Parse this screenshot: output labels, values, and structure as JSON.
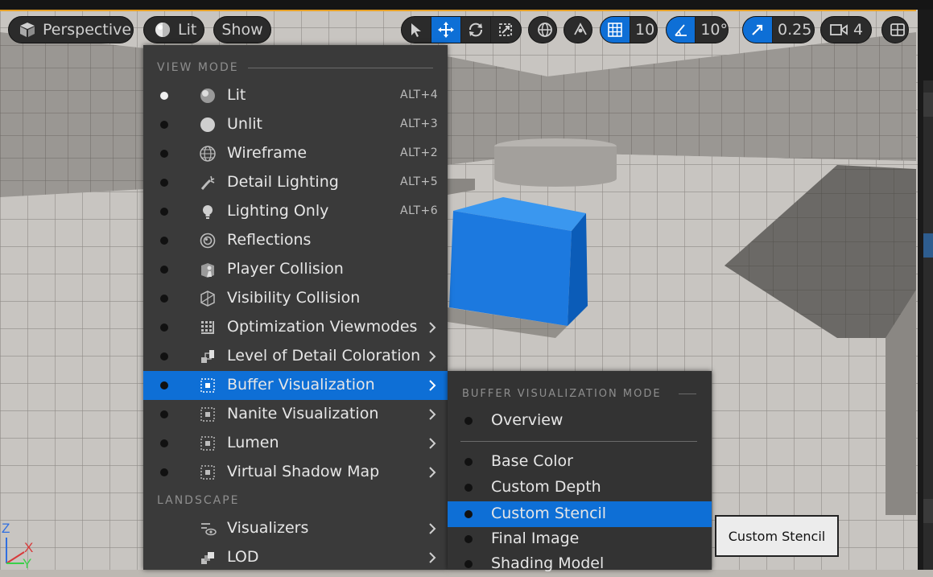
{
  "toolbar": {
    "perspective_label": "Perspective",
    "lit_label": "Lit",
    "show_label": "Show",
    "grid_value": "10",
    "angle_value": "10°",
    "scale_value": "0.25",
    "camera_speed": "4"
  },
  "colors": {
    "accent": "#0e6fd6",
    "menu_bg": "#3a3a3a",
    "submenu_bg": "#333333",
    "highlight_frame": "#e7a126"
  },
  "view_mode_menu": {
    "section_view_mode": "VIEW MODE",
    "section_landscape": "LANDSCAPE",
    "items": [
      {
        "label": "Lit",
        "shortcut": "ALT+4",
        "icon": "lit-sphere-icon"
      },
      {
        "label": "Unlit",
        "shortcut": "ALT+3",
        "icon": "unlit-sphere-icon"
      },
      {
        "label": "Wireframe",
        "shortcut": "ALT+2",
        "icon": "wireframe-globe-icon"
      },
      {
        "label": "Detail Lighting",
        "shortcut": "ALT+5",
        "icon": "detail-lighting-icon"
      },
      {
        "label": "Lighting Only",
        "shortcut": "ALT+6",
        "icon": "lightbulb-icon"
      },
      {
        "label": "Reflections",
        "shortcut": "",
        "icon": "reflections-icon"
      },
      {
        "label": "Player Collision",
        "shortcut": "",
        "icon": "player-collision-icon"
      },
      {
        "label": "Visibility Collision",
        "shortcut": "",
        "icon": "visibility-collision-icon"
      },
      {
        "label": "Optimization Viewmodes",
        "shortcut": "",
        "icon": "optimization-grid-icon"
      },
      {
        "label": "Level of Detail Coloration",
        "shortcut": "",
        "icon": "lod-coloration-icon"
      },
      {
        "label": "Buffer Visualization",
        "shortcut": "",
        "icon": "buffer-visualization-icon"
      },
      {
        "label": "Nanite Visualization",
        "shortcut": "",
        "icon": "nanite-icon"
      },
      {
        "label": "Lumen",
        "shortcut": "",
        "icon": "lumen-icon"
      },
      {
        "label": "Virtual Shadow Map",
        "shortcut": "",
        "icon": "virtual-shadow-map-icon"
      }
    ],
    "landscape_items": [
      {
        "label": "Visualizers",
        "icon": "visualizers-icon"
      },
      {
        "label": "LOD",
        "icon": "lod-icon"
      }
    ]
  },
  "buffer_submenu": {
    "section": "BUFFER VISUALIZATION MODE",
    "overview": "Overview",
    "items": [
      "Base Color",
      "Custom Depth",
      "Custom Stencil",
      "Final Image",
      "Shading Model"
    ],
    "selected": "Custom Stencil"
  },
  "tooltip": {
    "text": "Custom Stencil"
  },
  "axis_gizmo": {
    "z": "Z",
    "x": "X",
    "y": "Y"
  }
}
